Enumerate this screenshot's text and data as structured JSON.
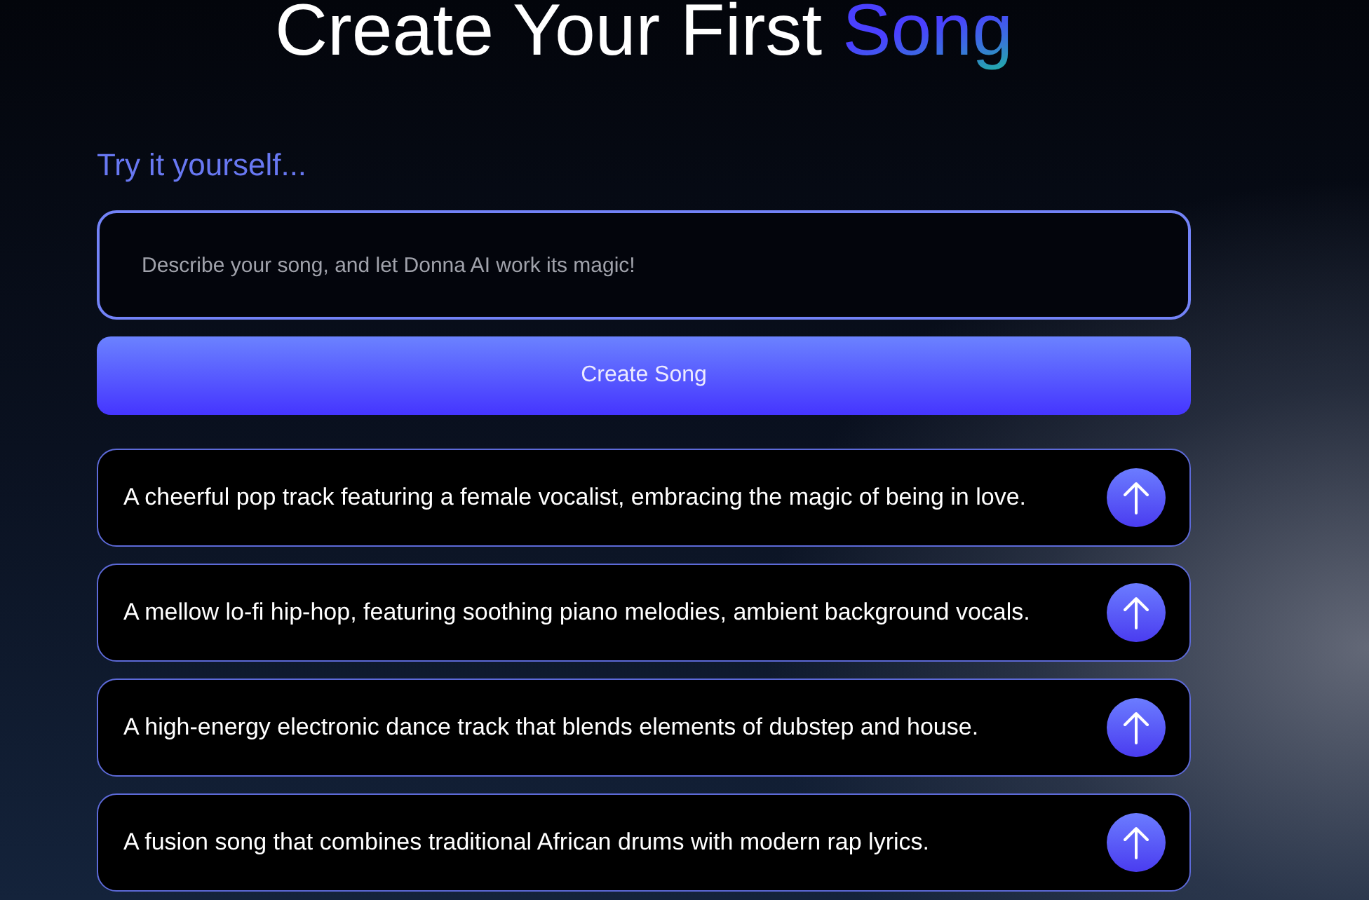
{
  "title": {
    "text": "Create Your First",
    "highlight": "Song"
  },
  "prompt_label": "Try it yourself...",
  "input": {
    "placeholder": "Describe your song, and let Donna AI work its magic!"
  },
  "create_button": "Create Song",
  "suggestions": [
    {
      "text": "A cheerful pop track featuring a female vocalist, embracing the magic of being in love."
    },
    {
      "text": "A mellow lo-fi hip-hop, featuring soothing piano melodies, ambient background vocals."
    },
    {
      "text": "A high-energy electronic dance track that blends elements of dubstep and house."
    },
    {
      "text": "A fusion song that combines traditional African drums with modern rap lyrics."
    }
  ]
}
